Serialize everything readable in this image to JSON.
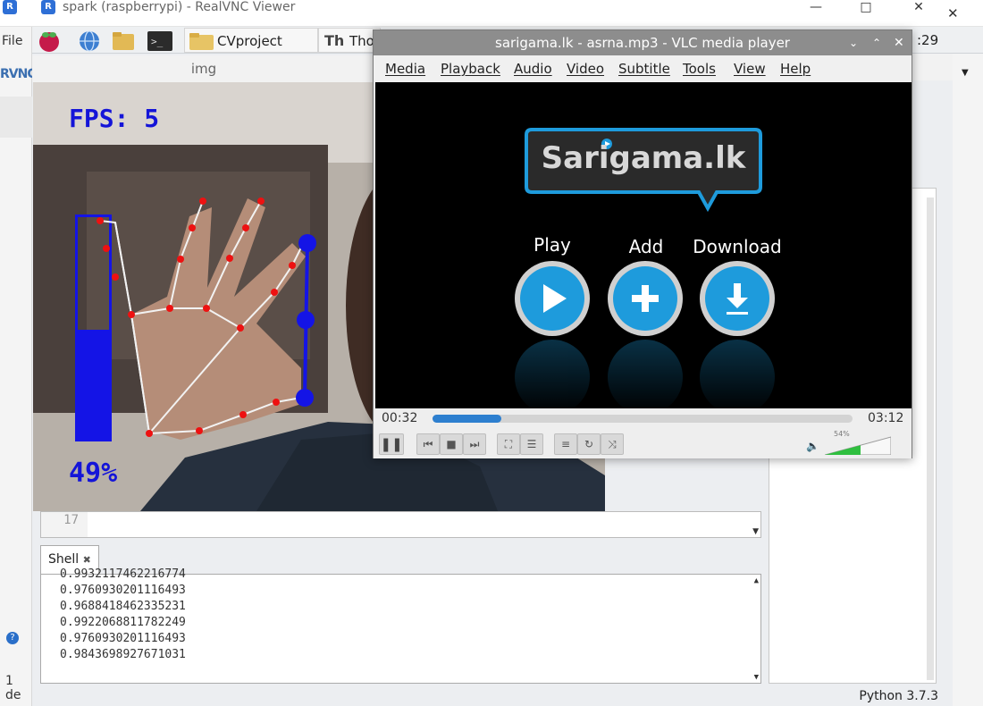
{
  "vnc": {
    "title": "spark (raspberrypi) - RealVNC Viewer",
    "host_menu_file": "File",
    "host_logo_fragment": "RVNC",
    "host_status_fragment": "1 de"
  },
  "taskbar": {
    "folder_label": "CVproject",
    "thonny_label": "Tho",
    "clock_fragment": ":29"
  },
  "img_window": {
    "title": "img",
    "fps_text": "FPS: 5",
    "volume_percent_text": "49%",
    "volume_level": 0.49
  },
  "editor": {
    "line_number": "17"
  },
  "shell": {
    "tab_label": "Shell",
    "lines": [
      "0.9760930201116493",
      "0.9688418462335231",
      "0.9922068811782249",
      "0.9760930201116493",
      "0.9843698927671031"
    ],
    "partial_top_line": "0.9932117462216774"
  },
  "statusbar": {
    "interpreter": "Python 3.7.3"
  },
  "vlc": {
    "title": "sarigama.lk - asrna.mp3 - VLC media player",
    "menu": [
      "Media",
      "Playback",
      "Audio",
      "Video",
      "Subtitle",
      "Tools",
      "View",
      "Help"
    ],
    "logo_text": "Sarigama.lk",
    "buttons": [
      "Play",
      "Add",
      "Download"
    ],
    "time_elapsed": "00:32",
    "time_total": "03:12",
    "progress": 0.164,
    "volume_text": "54%",
    "volume_level": 0.54,
    "accent": "#1e9bdc"
  }
}
